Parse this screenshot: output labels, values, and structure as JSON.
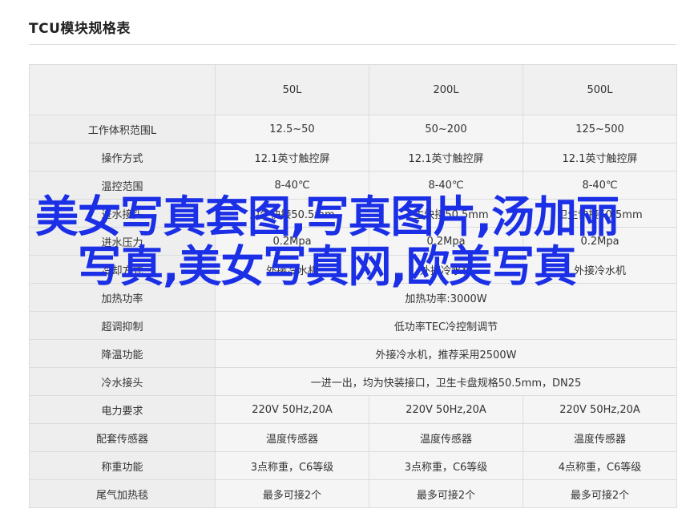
{
  "title": "TCU模块规格表",
  "columns": [
    "",
    "50L",
    "200L",
    "500L"
  ],
  "rows": [
    {
      "label": "工作体积范围L",
      "cells": [
        "12.5~50",
        "50~200",
        "125~500"
      ]
    },
    {
      "label": "操作方式",
      "cells": [
        "12.1英寸触控屏",
        "12.1英寸触控屏",
        "12.1英寸触控屏"
      ]
    },
    {
      "label": "温控范围",
      "cells": [
        "8-40℃",
        "8-40℃",
        "8-40℃"
      ]
    },
    {
      "label": "进水接头",
      "cells": [
        "卫生快接50.5mm",
        "卫生快接50.5mm",
        "卫生快接50.5mm"
      ]
    },
    {
      "label": "进水压力",
      "cells": [
        "0.2Mpa",
        "0.2Mpa",
        "0.2Mpa"
      ]
    },
    {
      "label": "冷却方式",
      "cells": [
        "外接冷水机",
        "外接冷水机",
        "外接冷水机"
      ]
    },
    {
      "label": "加热功率",
      "merged": "加热功率:3000W"
    },
    {
      "label": "超调抑制",
      "merged": "低功率TEC冷控制调节"
    },
    {
      "label": "降温功能",
      "merged": "外接冷水机，推荐采用2500W"
    },
    {
      "label": "冷水接头",
      "merged": "一进一出，均为快装接口，卫生卡盘规格50.5mm，DN25"
    },
    {
      "label": "电力要求",
      "cells": [
        "220V 50Hz,20A",
        "220V 50Hz,20A",
        "220V 50Hz,20A"
      ]
    },
    {
      "label": "配套传感器",
      "cells": [
        "温度传感器",
        "温度传感器",
        "温度传感器"
      ]
    },
    {
      "label": "称重功能",
      "cells": [
        "3点称重，C6等级",
        "3点称重，C6等级",
        "4点称重，C6等级"
      ]
    },
    {
      "label": "尾气加热毯",
      "cells": [
        "最多可接2个",
        "最多可接2个",
        "最多可接2个"
      ]
    }
  ],
  "overlay_text": "美女写真套图,写真图片,汤加丽写真,美女写真网,欧美写真"
}
